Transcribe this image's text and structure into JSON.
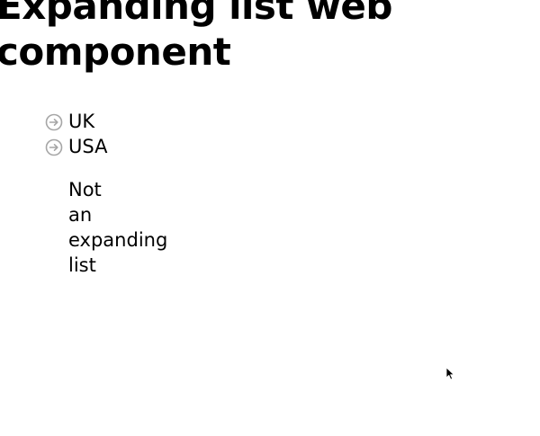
{
  "page": {
    "title": "Expanding list web component"
  },
  "expanding_list": {
    "items": [
      {
        "label": "UK",
        "icon": "arrow-right-circle-icon"
      },
      {
        "label": "USA",
        "icon": "arrow-right-circle-icon"
      }
    ]
  },
  "plain_list": {
    "items": [
      {
        "label": "Not an expanding list"
      }
    ]
  },
  "colors": {
    "text": "#000000",
    "icon": "#a6a6a6",
    "background": "#ffffff"
  }
}
